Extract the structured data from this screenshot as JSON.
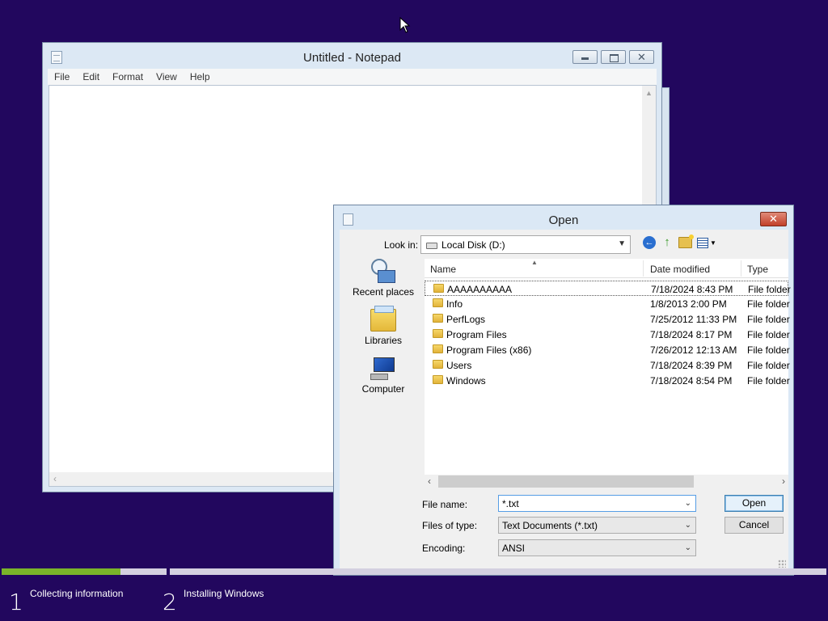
{
  "notepad": {
    "title": "Untitled - Notepad",
    "menu": [
      "File",
      "Edit",
      "Format",
      "View",
      "Help"
    ],
    "close_glyph": "✕"
  },
  "open_dialog": {
    "title": "Open",
    "close_glyph": "✕",
    "look_in_label": "Look in:",
    "look_in_value": "Local Disk (D:)",
    "places": [
      "Recent places",
      "Libraries",
      "Computer"
    ],
    "columns": {
      "name": "Name",
      "date": "Date modified",
      "type": "Type"
    },
    "files": [
      {
        "name": "AAAAAAAAAA",
        "date": "7/18/2024 8:43 PM",
        "type": "File folder"
      },
      {
        "name": "Info",
        "date": "1/8/2013 2:00 PM",
        "type": "File folder"
      },
      {
        "name": "PerfLogs",
        "date": "7/25/2012 11:33 PM",
        "type": "File folder"
      },
      {
        "name": "Program Files",
        "date": "7/18/2024 8:17 PM",
        "type": "File folder"
      },
      {
        "name": "Program Files (x86)",
        "date": "7/26/2012 12:13 AM",
        "type": "File folder"
      },
      {
        "name": "Users",
        "date": "7/18/2024 8:39 PM",
        "type": "File folder"
      },
      {
        "name": "Windows",
        "date": "7/18/2024 8:54 PM",
        "type": "File folder"
      }
    ],
    "file_name_label": "File name:",
    "file_name_value": "*.txt",
    "file_type_label": "Files of type:",
    "file_type_value": "Text Documents (*.txt)",
    "encoding_label": "Encoding:",
    "encoding_value": "ANSI",
    "open_button": "Open",
    "cancel_button": "Cancel"
  },
  "setup": {
    "progress": 0.72,
    "steps": [
      {
        "number": "1",
        "label": "Collecting information"
      },
      {
        "number": "2",
        "label": "Installing Windows"
      }
    ]
  },
  "colors": {
    "desktop": "#22075e",
    "progress_fill": "#7ab42a",
    "close_red": "#c2402a"
  }
}
